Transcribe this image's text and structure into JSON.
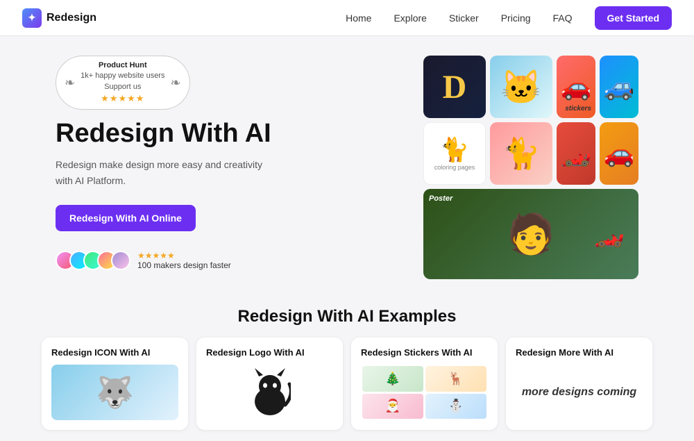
{
  "nav": {
    "logo_text": "Redesign",
    "links": [
      "Home",
      "Explore",
      "Sticker",
      "Pricing",
      "FAQ"
    ],
    "cta_label": "Get Started"
  },
  "hero": {
    "badge": {
      "platform": "Product Hunt",
      "users": "1k+ happy website users",
      "support": "Support us",
      "stars": "★★★★★"
    },
    "title": "Redesign With AI",
    "subtitle": "Redesign make design more easy and creativity with AI Platform.",
    "cta_label": "Redesign With AI Online",
    "social": {
      "stars": "★★★★★",
      "makers_text": "100 makers design faster"
    }
  },
  "examples": {
    "section_title": "Redesign With AI Examples",
    "cards": [
      {
        "title": "Redesign ICON With AI",
        "type": "icon"
      },
      {
        "title": "Redesign Logo With AI",
        "type": "logo"
      },
      {
        "title": "Redesign Stickers With AI",
        "type": "stickers"
      },
      {
        "title": "Redesign More With AI",
        "type": "more"
      }
    ],
    "more_text": "more designs coming"
  }
}
